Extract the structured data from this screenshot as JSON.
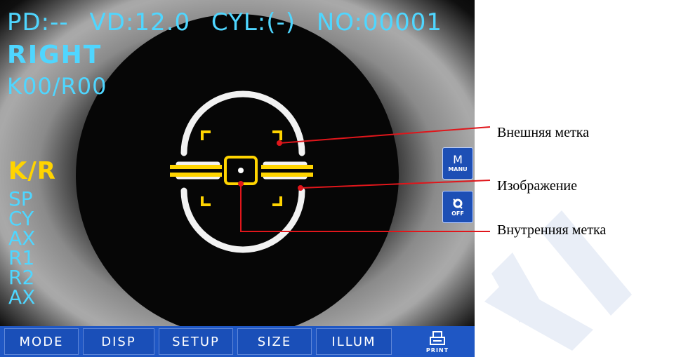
{
  "header": {
    "pd": "PD:--",
    "vd": "VD:12.0",
    "cyl": "CYL:(-)",
    "no": "NO:00001"
  },
  "eye_side": "RIGHT",
  "kr_code": "K00/R00",
  "mode_label": "K/R",
  "measurements": [
    "SP",
    "CY",
    "AX",
    "R1",
    "R2",
    "AX"
  ],
  "side_buttons": {
    "manual": {
      "icon": "M",
      "label": "MANU"
    },
    "illumination": {
      "icon": "illumination-icon",
      "label": "OFF"
    }
  },
  "menu": [
    "MODE",
    "DISP",
    "SETUP",
    "SIZE",
    "ILLUM"
  ],
  "print": {
    "icon": "printer-icon",
    "label": "PRINT"
  },
  "annotations": {
    "outer_mark": "Внешняя метка",
    "image": "Изображение",
    "inner_mark": "Внутренняя метка"
  },
  "colors": {
    "hud_cyan": "#4fd6ff",
    "target_yellow": "#ffd400",
    "menu_blue": "#1f57c4",
    "callout_red": "#e0161b"
  }
}
